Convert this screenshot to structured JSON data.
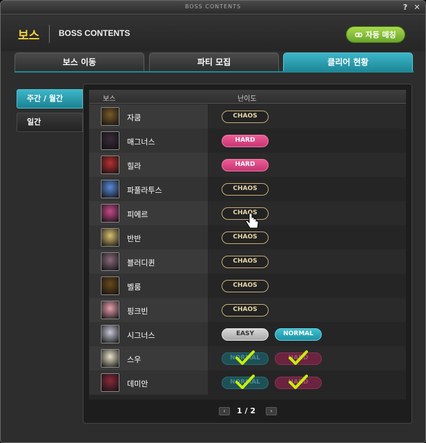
{
  "window": {
    "title": "BOSS CONTENTS",
    "help_glyph": "?",
    "close_glyph": "✕"
  },
  "header": {
    "boss_label": "보스",
    "sub_title": "BOSS CONTENTS",
    "auto_match_label": "자동 매칭"
  },
  "tabs": [
    {
      "label": "보스 이동",
      "active": false
    },
    {
      "label": "파티 모집",
      "active": false
    },
    {
      "label": "클리어 현황",
      "active": true
    }
  ],
  "sidebar": [
    {
      "label": "주간 / 월간",
      "active": true
    },
    {
      "label": "일간",
      "active": false
    }
  ],
  "list": {
    "col_boss": "보스",
    "col_difficulty": "난이도",
    "rows": [
      {
        "name": "자쿰",
        "portrait_color": "#7a5a2a",
        "difficulties": [
          {
            "label": "CHAOS",
            "style": "chaos",
            "cleared": false
          }
        ]
      },
      {
        "name": "매그너스",
        "portrait_color": "#3a2a3a",
        "difficulties": [
          {
            "label": "HARD",
            "style": "hard",
            "cleared": false
          }
        ]
      },
      {
        "name": "힐라",
        "portrait_color": "#b83030",
        "difficulties": [
          {
            "label": "HARD",
            "style": "hard",
            "cleared": false
          }
        ]
      },
      {
        "name": "파풀라투스",
        "portrait_color": "#5a8ad8",
        "difficulties": [
          {
            "label": "CHAOS",
            "style": "chaos",
            "cleared": false
          }
        ]
      },
      {
        "name": "피에르",
        "portrait_color": "#c84a8a",
        "difficulties": [
          {
            "label": "CHAOS",
            "style": "chaos",
            "cleared": false
          }
        ]
      },
      {
        "name": "반반",
        "portrait_color": "#d8c070",
        "difficulties": [
          {
            "label": "CHAOS",
            "style": "chaos",
            "cleared": false
          }
        ]
      },
      {
        "name": "블러디퀸",
        "portrait_color": "#8a6a7a",
        "difficulties": [
          {
            "label": "CHAOS",
            "style": "chaos",
            "cleared": false
          }
        ]
      },
      {
        "name": "벨룸",
        "portrait_color": "#6a4a1a",
        "difficulties": [
          {
            "label": "CHAOS",
            "style": "chaos",
            "cleared": false
          }
        ]
      },
      {
        "name": "핑크빈",
        "portrait_color": "#e8a0b0",
        "difficulties": [
          {
            "label": "CHAOS",
            "style": "chaos",
            "cleared": false
          }
        ]
      },
      {
        "name": "시그너스",
        "portrait_color": "#c8c8d8",
        "difficulties": [
          {
            "label": "EASY",
            "style": "easy",
            "cleared": false
          },
          {
            "label": "NORMAL",
            "style": "normal",
            "cleared": false
          }
        ]
      },
      {
        "name": "스우",
        "portrait_color": "#e8e0c8",
        "difficulties": [
          {
            "label": "NORMAL",
            "style": "normal",
            "cleared": true
          },
          {
            "label": "HARD",
            "style": "hard",
            "cleared": true
          }
        ]
      },
      {
        "name": "데미안",
        "portrait_color": "#8a2a3a",
        "difficulties": [
          {
            "label": "NORMAL",
            "style": "normal",
            "cleared": true
          },
          {
            "label": "HARD",
            "style": "hard",
            "cleared": true
          }
        ]
      }
    ]
  },
  "pager": {
    "text": "1 / 2",
    "prev_glyph": "‹",
    "next_glyph": "›"
  },
  "colors": {
    "accent_teal": "#2aa5b8",
    "gold": "#f2d33a",
    "green_button": "#8cc83a",
    "check": "#c8f000"
  }
}
